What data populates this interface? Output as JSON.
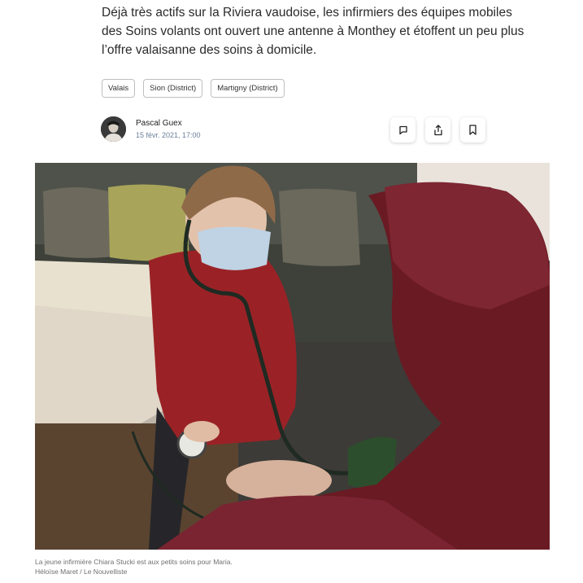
{
  "article": {
    "lede": "Déjà très actifs sur la Riviera vaudoise, les infirmiers des équipes mobiles des Soins volants ont ouvert une antenne à Monthey et étoffent un peu plus l’offre valaisanne des soins à domicile."
  },
  "tags": [
    {
      "label": "Valais"
    },
    {
      "label": "Sion (District)"
    },
    {
      "label": "Martigny (District)"
    }
  ],
  "author": {
    "name": "Pascal Guex",
    "date": "15 févr. 2021, 17:00"
  },
  "actions": {
    "comment_icon": "comment-icon",
    "share_icon": "share-icon",
    "bookmark_icon": "bookmark-icon"
  },
  "photo": {
    "caption": "La jeune infirmière Chiara Stucki est aux petits soins pour Maria.",
    "credit": "Héloïse Maret / Le Nouvelliste"
  }
}
